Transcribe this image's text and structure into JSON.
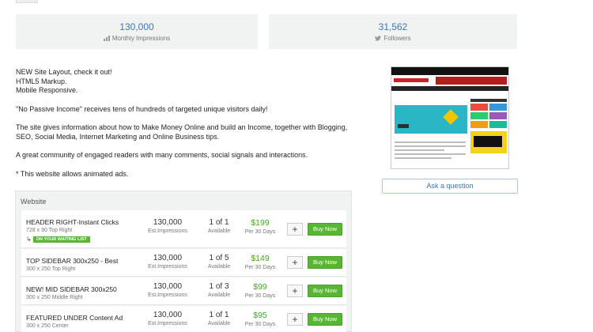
{
  "stats": {
    "impressions": {
      "value": "130,000",
      "label": "Monthly Impressions",
      "icon": "bar-chart-icon"
    },
    "followers": {
      "value": "31,562",
      "label": "Followers",
      "icon": "twitter-bird-icon"
    }
  },
  "description": {
    "line1": "NEW Site Layout, check it out!",
    "line2": "HTML5 Markup.",
    "line3": "Mobile Responsive.",
    "para2": "\"No Passive Income\" receives tens of hundreds of targeted unique visitors daily!",
    "para3": "The site gives information about how to Make Money Online and build an Income, together with Blogging, SEO, Social Media, Internet Marketing and Online Business tips.",
    "para4": "A great community of engaged readers with many comments, social signals and interactions.",
    "para5": "* This website allows animated ads."
  },
  "ask_button": "Ask a question",
  "panel": {
    "title": "Website",
    "rows": [
      {
        "name": "HEADER RIGHT-Instant Clicks",
        "sub": "728 x 90 Top Right",
        "impressions": "130,000",
        "imp_label": "Est.Impressions",
        "count": "1 of 1",
        "count_label": "Available",
        "price": "$199",
        "price_label": "Per 30 Days",
        "buy": "Buy Now",
        "waiting": "ON YOUR WAITING LIST"
      },
      {
        "name": "TOP SIDEBAR 300x250 - Best",
        "sub": "300 x 250 Top Right",
        "impressions": "130,000",
        "imp_label": "Est.Impressions",
        "count": "1 of 5",
        "count_label": "Available",
        "price": "$149",
        "price_label": "Per 30 Days",
        "buy": "Buy Now"
      },
      {
        "name": "NEW! MID SIDEBAR 300x250",
        "sub": "300 x 250 Middle Right",
        "impressions": "130,000",
        "imp_label": "Est.Impressions",
        "count": "1 of 3",
        "count_label": "Available",
        "price": "$99",
        "price_label": "Per 30 Days",
        "buy": "Buy Now"
      },
      {
        "name": "FEATURED UNDER Content Ad",
        "sub": "300 x 250 Center",
        "impressions": "130,000",
        "imp_label": "Est.Impressions",
        "count": "1 of 1",
        "count_label": "Available",
        "price": "$95",
        "price_label": "Per 30 Days",
        "buy": "Buy Now"
      }
    ]
  },
  "colors": {
    "link_blue": "#3b77b6",
    "price_green": "#47a325",
    "button_green": "#59b634",
    "panel_bg": "#f1f2f2"
  }
}
